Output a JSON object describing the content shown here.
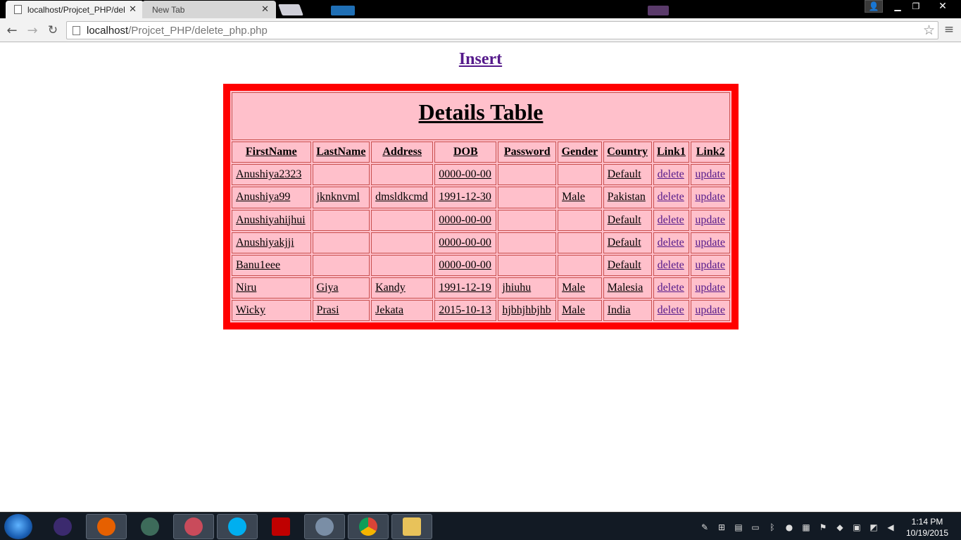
{
  "browser": {
    "tabs": [
      {
        "title": "localhost/Projcet_PHP/del",
        "close": "✕"
      },
      {
        "title": "New Tab",
        "close": "✕"
      }
    ],
    "url_host": "localhost",
    "url_path": "/Projcet_PHP/delete_php.php",
    "star_icon": "☆",
    "menu_icon": "≡"
  },
  "page": {
    "insert_link": "Insert",
    "table": {
      "title": "Details Table",
      "headers": [
        "FirstName",
        "LastName",
        "Address",
        "DOB",
        "Password",
        "Gender",
        "Country",
        "Link1",
        "Link2"
      ],
      "rows": [
        [
          "Anushiya2323",
          "",
          "",
          "0000-00-00",
          "",
          "",
          "Default",
          "delete",
          "update"
        ],
        [
          "Anushiya99",
          "jknknvml",
          "dmsldkcmd",
          "1991-12-30",
          "",
          "Male",
          "Pakistan",
          "delete",
          "update"
        ],
        [
          "Anushiyahijhui",
          "",
          "",
          "0000-00-00",
          "",
          "",
          "Default",
          "delete",
          "update"
        ],
        [
          "Anushiyakjji",
          "",
          "",
          "0000-00-00",
          "",
          "",
          "Default",
          "delete",
          "update"
        ],
        [
          "Banu1eee",
          "",
          "",
          "0000-00-00",
          "",
          "",
          "Default",
          "delete",
          "update"
        ],
        [
          "Niru",
          "Giya",
          "Kandy",
          "1991-12-19",
          "jhiuhu",
          "Male",
          "Malesia",
          "delete",
          "update"
        ],
        [
          "Wicky",
          "Prasi",
          "Jekata",
          "2015-10-13",
          "hjbhjhbjhb",
          "Male",
          "India",
          "delete",
          "update"
        ]
      ]
    }
  },
  "taskbar": {
    "time": "1:14 PM",
    "date": "10/19/2015"
  },
  "colors": {
    "table_border": "#ff0000",
    "table_bg": "#ffc0cb",
    "link": "#551a8b"
  }
}
